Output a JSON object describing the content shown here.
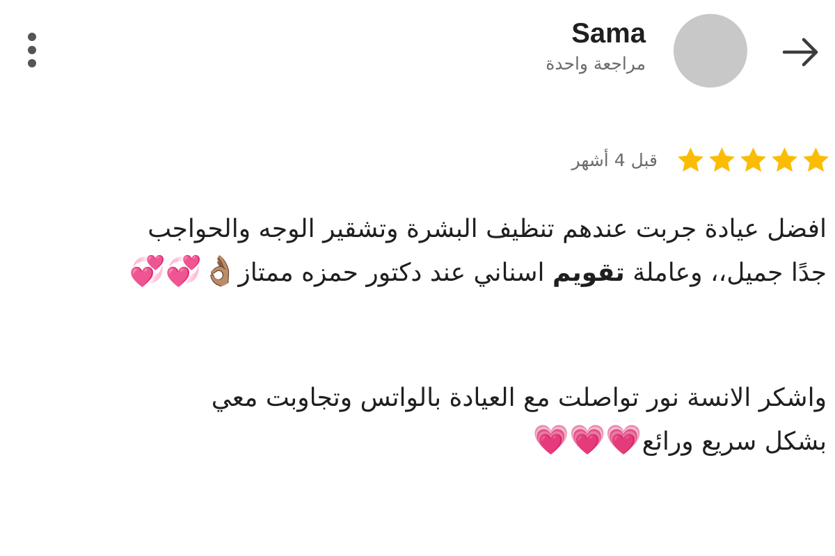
{
  "header": {
    "back_icon": "arrow-back-icon",
    "user_name": "Sama",
    "review_count": "مراجعة واحدة",
    "avatar_color": "#c8c8c8",
    "more_icon": "more-vert-icon"
  },
  "review": {
    "rating": 5,
    "rating_max": 5,
    "star_color": "#fbbc04",
    "date": "قبل 4 أشهر",
    "paragraph1": {
      "line1": "افضل عيادة جربت عندهم تنظيف البشرة وتشقير الوجه والحواجب",
      "line2_part1": "جدًا جميل،، وعاملة ",
      "line2_bold": "تقويم",
      "line2_part2": " اسناني عند دكتور حمزه ممتاز",
      "emojis": "👌🏽💞💞"
    },
    "paragraph2": {
      "line1": "واشكر الانسة نور تواصلت مع العيادة بالواتس وتجاوبت معي",
      "line2": "بشكل سريع ورائع",
      "emojis": "💗💗💗"
    }
  }
}
